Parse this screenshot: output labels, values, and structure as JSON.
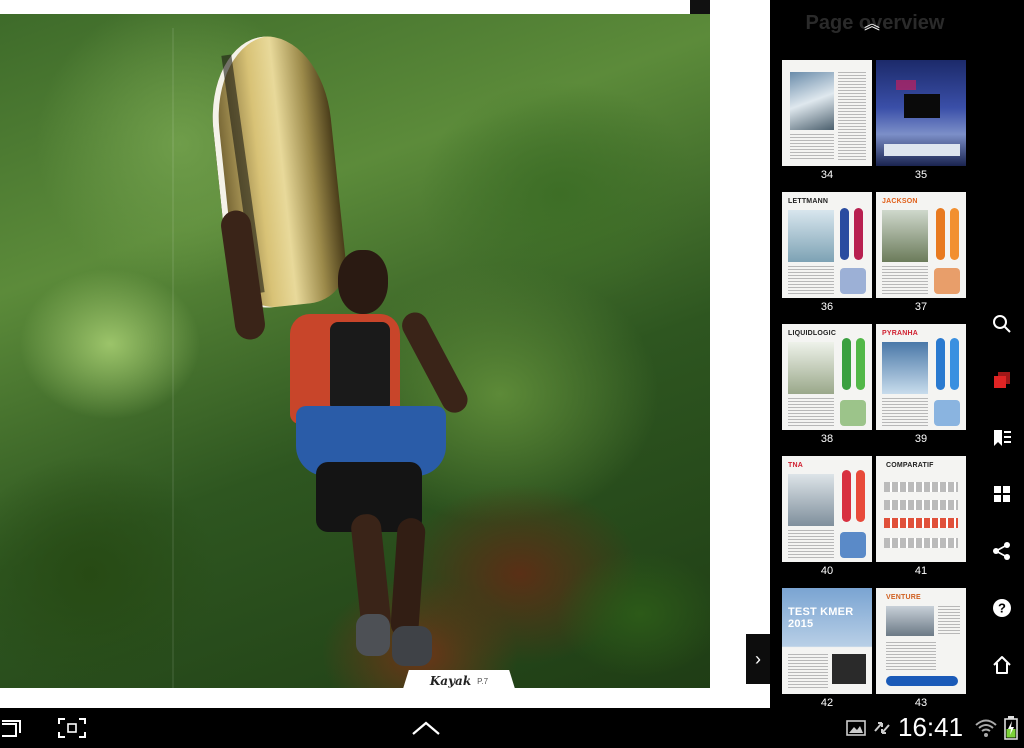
{
  "reader": {
    "folio_brand": "Kayak",
    "folio_page": "P.7",
    "open_panel_arrow": "›"
  },
  "overview": {
    "title": "Page overview",
    "collapse_glyph": "︽",
    "pages": [
      {
        "num": "34",
        "title": ""
      },
      {
        "num": "35",
        "title": ""
      },
      {
        "num": "36",
        "title": "LETTMANN"
      },
      {
        "num": "37",
        "title": "JACKSON"
      },
      {
        "num": "38",
        "title": "LIQUIDLOGIC"
      },
      {
        "num": "39",
        "title": "PYRANHA"
      },
      {
        "num": "40",
        "title": "TNA"
      },
      {
        "num": "41",
        "title": "COMPARATIF"
      },
      {
        "num": "42",
        "title": "TEST KMER 2015"
      },
      {
        "num": "43",
        "title": "VENTURE"
      }
    ]
  },
  "actions": [
    {
      "name": "search-icon"
    },
    {
      "name": "pages-icon",
      "active_color": "#e02424"
    },
    {
      "name": "bookmarks-icon"
    },
    {
      "name": "grid-icon"
    },
    {
      "name": "share-icon"
    },
    {
      "name": "help-icon"
    },
    {
      "name": "home-icon"
    }
  ],
  "system": {
    "clock": "16:41",
    "icons": [
      "recent-apps-icon",
      "screenshot-icon",
      "home-up-icon",
      "gallery-icon",
      "sync-icon",
      "wifi-icon",
      "battery-icon"
    ]
  },
  "colors": {
    "accent_red": "#e02424",
    "panel_bg": "#000000",
    "page_bg": "#ffffff"
  }
}
